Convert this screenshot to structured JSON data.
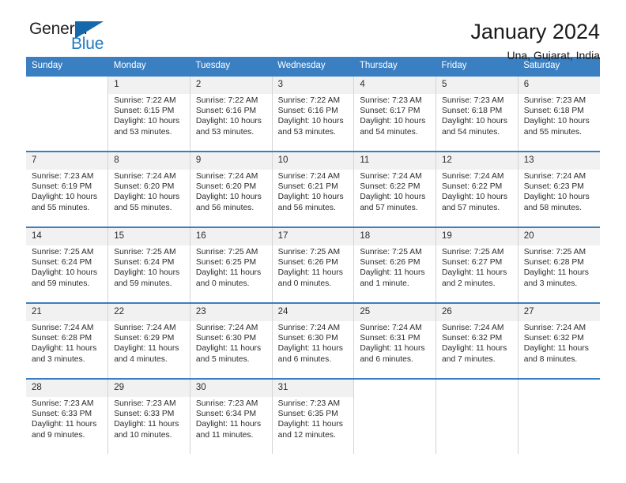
{
  "brand": {
    "name_part1": "General",
    "name_part2": "Blue",
    "accent_color": "#1f7ac4",
    "triangle_color": "#1569ab",
    "logo_icon": "triangle-icon"
  },
  "header": {
    "title": "January 2024",
    "subtitle": "Una, Gujarat, India"
  },
  "calendar": {
    "header_bg": "#3a7fc1",
    "day_band_bg": "#f1f1f1",
    "weekdays": [
      "Sunday",
      "Monday",
      "Tuesday",
      "Wednesday",
      "Thursday",
      "Friday",
      "Saturday"
    ],
    "weeks": [
      [
        {
          "day": "",
          "lines": []
        },
        {
          "day": "1",
          "lines": [
            "Sunrise: 7:22 AM",
            "Sunset: 6:15 PM",
            "Daylight: 10 hours",
            "and 53 minutes."
          ]
        },
        {
          "day": "2",
          "lines": [
            "Sunrise: 7:22 AM",
            "Sunset: 6:16 PM",
            "Daylight: 10 hours",
            "and 53 minutes."
          ]
        },
        {
          "day": "3",
          "lines": [
            "Sunrise: 7:22 AM",
            "Sunset: 6:16 PM",
            "Daylight: 10 hours",
            "and 53 minutes."
          ]
        },
        {
          "day": "4",
          "lines": [
            "Sunrise: 7:23 AM",
            "Sunset: 6:17 PM",
            "Daylight: 10 hours",
            "and 54 minutes."
          ]
        },
        {
          "day": "5",
          "lines": [
            "Sunrise: 7:23 AM",
            "Sunset: 6:18 PM",
            "Daylight: 10 hours",
            "and 54 minutes."
          ]
        },
        {
          "day": "6",
          "lines": [
            "Sunrise: 7:23 AM",
            "Sunset: 6:18 PM",
            "Daylight: 10 hours",
            "and 55 minutes."
          ]
        }
      ],
      [
        {
          "day": "7",
          "lines": [
            "Sunrise: 7:23 AM",
            "Sunset: 6:19 PM",
            "Daylight: 10 hours",
            "and 55 minutes."
          ]
        },
        {
          "day": "8",
          "lines": [
            "Sunrise: 7:24 AM",
            "Sunset: 6:20 PM",
            "Daylight: 10 hours",
            "and 55 minutes."
          ]
        },
        {
          "day": "9",
          "lines": [
            "Sunrise: 7:24 AM",
            "Sunset: 6:20 PM",
            "Daylight: 10 hours",
            "and 56 minutes."
          ]
        },
        {
          "day": "10",
          "lines": [
            "Sunrise: 7:24 AM",
            "Sunset: 6:21 PM",
            "Daylight: 10 hours",
            "and 56 minutes."
          ]
        },
        {
          "day": "11",
          "lines": [
            "Sunrise: 7:24 AM",
            "Sunset: 6:22 PM",
            "Daylight: 10 hours",
            "and 57 minutes."
          ]
        },
        {
          "day": "12",
          "lines": [
            "Sunrise: 7:24 AM",
            "Sunset: 6:22 PM",
            "Daylight: 10 hours",
            "and 57 minutes."
          ]
        },
        {
          "day": "13",
          "lines": [
            "Sunrise: 7:24 AM",
            "Sunset: 6:23 PM",
            "Daylight: 10 hours",
            "and 58 minutes."
          ]
        }
      ],
      [
        {
          "day": "14",
          "lines": [
            "Sunrise: 7:25 AM",
            "Sunset: 6:24 PM",
            "Daylight: 10 hours",
            "and 59 minutes."
          ]
        },
        {
          "day": "15",
          "lines": [
            "Sunrise: 7:25 AM",
            "Sunset: 6:24 PM",
            "Daylight: 10 hours",
            "and 59 minutes."
          ]
        },
        {
          "day": "16",
          "lines": [
            "Sunrise: 7:25 AM",
            "Sunset: 6:25 PM",
            "Daylight: 11 hours",
            "and 0 minutes."
          ]
        },
        {
          "day": "17",
          "lines": [
            "Sunrise: 7:25 AM",
            "Sunset: 6:26 PM",
            "Daylight: 11 hours",
            "and 0 minutes."
          ]
        },
        {
          "day": "18",
          "lines": [
            "Sunrise: 7:25 AM",
            "Sunset: 6:26 PM",
            "Daylight: 11 hours",
            "and 1 minute."
          ]
        },
        {
          "day": "19",
          "lines": [
            "Sunrise: 7:25 AM",
            "Sunset: 6:27 PM",
            "Daylight: 11 hours",
            "and 2 minutes."
          ]
        },
        {
          "day": "20",
          "lines": [
            "Sunrise: 7:25 AM",
            "Sunset: 6:28 PM",
            "Daylight: 11 hours",
            "and 3 minutes."
          ]
        }
      ],
      [
        {
          "day": "21",
          "lines": [
            "Sunrise: 7:24 AM",
            "Sunset: 6:28 PM",
            "Daylight: 11 hours",
            "and 3 minutes."
          ]
        },
        {
          "day": "22",
          "lines": [
            "Sunrise: 7:24 AM",
            "Sunset: 6:29 PM",
            "Daylight: 11 hours",
            "and 4 minutes."
          ]
        },
        {
          "day": "23",
          "lines": [
            "Sunrise: 7:24 AM",
            "Sunset: 6:30 PM",
            "Daylight: 11 hours",
            "and 5 minutes."
          ]
        },
        {
          "day": "24",
          "lines": [
            "Sunrise: 7:24 AM",
            "Sunset: 6:30 PM",
            "Daylight: 11 hours",
            "and 6 minutes."
          ]
        },
        {
          "day": "25",
          "lines": [
            "Sunrise: 7:24 AM",
            "Sunset: 6:31 PM",
            "Daylight: 11 hours",
            "and 6 minutes."
          ]
        },
        {
          "day": "26",
          "lines": [
            "Sunrise: 7:24 AM",
            "Sunset: 6:32 PM",
            "Daylight: 11 hours",
            "and 7 minutes."
          ]
        },
        {
          "day": "27",
          "lines": [
            "Sunrise: 7:24 AM",
            "Sunset: 6:32 PM",
            "Daylight: 11 hours",
            "and 8 minutes."
          ]
        }
      ],
      [
        {
          "day": "28",
          "lines": [
            "Sunrise: 7:23 AM",
            "Sunset: 6:33 PM",
            "Daylight: 11 hours",
            "and 9 minutes."
          ]
        },
        {
          "day": "29",
          "lines": [
            "Sunrise: 7:23 AM",
            "Sunset: 6:33 PM",
            "Daylight: 11 hours",
            "and 10 minutes."
          ]
        },
        {
          "day": "30",
          "lines": [
            "Sunrise: 7:23 AM",
            "Sunset: 6:34 PM",
            "Daylight: 11 hours",
            "and 11 minutes."
          ]
        },
        {
          "day": "31",
          "lines": [
            "Sunrise: 7:23 AM",
            "Sunset: 6:35 PM",
            "Daylight: 11 hours",
            "and 12 minutes."
          ]
        },
        {
          "day": "",
          "lines": []
        },
        {
          "day": "",
          "lines": []
        },
        {
          "day": "",
          "lines": []
        }
      ]
    ]
  }
}
